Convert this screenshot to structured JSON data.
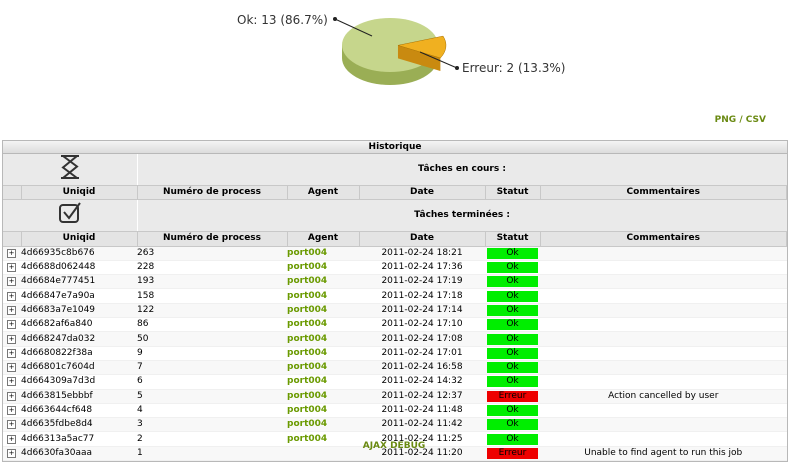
{
  "chart_data": {
    "type": "pie",
    "slices": [
      {
        "label": "Ok",
        "value": 13,
        "percent": 86.7,
        "text": "Ok: 13 (86.7%)",
        "color": "#c6d68c"
      },
      {
        "label": "Erreur",
        "value": 2,
        "percent": 13.3,
        "text": "Erreur: 2 (13.3%)",
        "color": "#f0b020"
      }
    ]
  },
  "export": {
    "png": "PNG",
    "sep": "/",
    "csv": "CSV"
  },
  "panel": {
    "title": "Historique",
    "running_title": "Tâches en cours :",
    "finished_title": "Tâches terminées :",
    "columns": [
      "Uniqid",
      "Numéro de process",
      "Agent",
      "Date",
      "Statut",
      "Commentaires"
    ]
  },
  "colors": {
    "ok": "#00ee00",
    "error": "#ee0000",
    "agent": "#6a9a00"
  },
  "rows": [
    {
      "uniqid": "4d66935c8b676",
      "process": "263",
      "agent": "port004",
      "date": "2011-02-24 18:21",
      "status": "Ok",
      "comment": ""
    },
    {
      "uniqid": "4d6688d062448",
      "process": "228",
      "agent": "port004",
      "date": "2011-02-24 17:36",
      "status": "Ok",
      "comment": ""
    },
    {
      "uniqid": "4d6684e777451",
      "process": "193",
      "agent": "port004",
      "date": "2011-02-24 17:19",
      "status": "Ok",
      "comment": ""
    },
    {
      "uniqid": "4d66847e7a90a",
      "process": "158",
      "agent": "port004",
      "date": "2011-02-24 17:18",
      "status": "Ok",
      "comment": ""
    },
    {
      "uniqid": "4d6683a7e1049",
      "process": "122",
      "agent": "port004",
      "date": "2011-02-24 17:14",
      "status": "Ok",
      "comment": ""
    },
    {
      "uniqid": "4d6682af6a840",
      "process": "86",
      "agent": "port004",
      "date": "2011-02-24 17:10",
      "status": "Ok",
      "comment": ""
    },
    {
      "uniqid": "4d668247da032",
      "process": "50",
      "agent": "port004",
      "date": "2011-02-24 17:08",
      "status": "Ok",
      "comment": ""
    },
    {
      "uniqid": "4d6680822f38a",
      "process": "9",
      "agent": "port004",
      "date": "2011-02-24 17:01",
      "status": "Ok",
      "comment": ""
    },
    {
      "uniqid": "4d66801c7604d",
      "process": "7",
      "agent": "port004",
      "date": "2011-02-24 16:58",
      "status": "Ok",
      "comment": ""
    },
    {
      "uniqid": "4d664309a7d3d",
      "process": "6",
      "agent": "port004",
      "date": "2011-02-24 14:32",
      "status": "Ok",
      "comment": ""
    },
    {
      "uniqid": "4d663815ebbbf",
      "process": "5",
      "agent": "port004",
      "date": "2011-02-24 12:37",
      "status": "Erreur",
      "comment": "Action cancelled by user"
    },
    {
      "uniqid": "4d663644cf648",
      "process": "4",
      "agent": "port004",
      "date": "2011-02-24 11:48",
      "status": "Ok",
      "comment": ""
    },
    {
      "uniqid": "4d6635fdbe8d4",
      "process": "3",
      "agent": "port004",
      "date": "2011-02-24 11:42",
      "status": "Ok",
      "comment": ""
    },
    {
      "uniqid": "4d66313a5ac77",
      "process": "2",
      "agent": "port004",
      "date": "2011-02-24 11:25",
      "status": "Ok",
      "comment": ""
    },
    {
      "uniqid": "4d6630fa30aaa",
      "process": "1",
      "agent": "",
      "date": "2011-02-24 11:20",
      "status": "Erreur",
      "comment": "Unable to find agent to run this job"
    }
  ],
  "footer": {
    "ajax_debug": "AJAX DEBUG"
  }
}
